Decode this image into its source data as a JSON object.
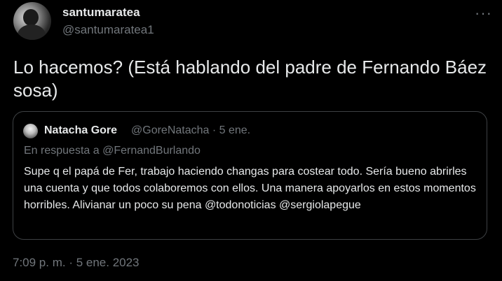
{
  "author": {
    "display_name": "santumaratea",
    "handle": "@santumaratea1"
  },
  "more_icon": "more-horizontal-icon",
  "tweet": {
    "text": "Lo hacemos? (Está hablando del padre de Fernando Báez sosa)",
    "timestamp": "7:09 p. m. · 5 ene. 2023"
  },
  "quoted_tweet": {
    "display_name": "Natacha Gore",
    "meta": "@GoreNatacha · 5 ene.",
    "reply_to": "En respuesta a @FernandBurlando",
    "text": "Supe q el papá de Fer, trabajo haciendo changas para costear todo. Sería bueno abrirles una cuenta y que todos colaboremos con ellos. Una manera apoyarlos en estos momentos horribles. Alivianar un poco su pena @todonoticias @sergiolapegue"
  },
  "colors": {
    "background": "#000000",
    "primary_text": "#e7e9ea",
    "secondary_text": "#71767b",
    "border": "#3e4144"
  }
}
